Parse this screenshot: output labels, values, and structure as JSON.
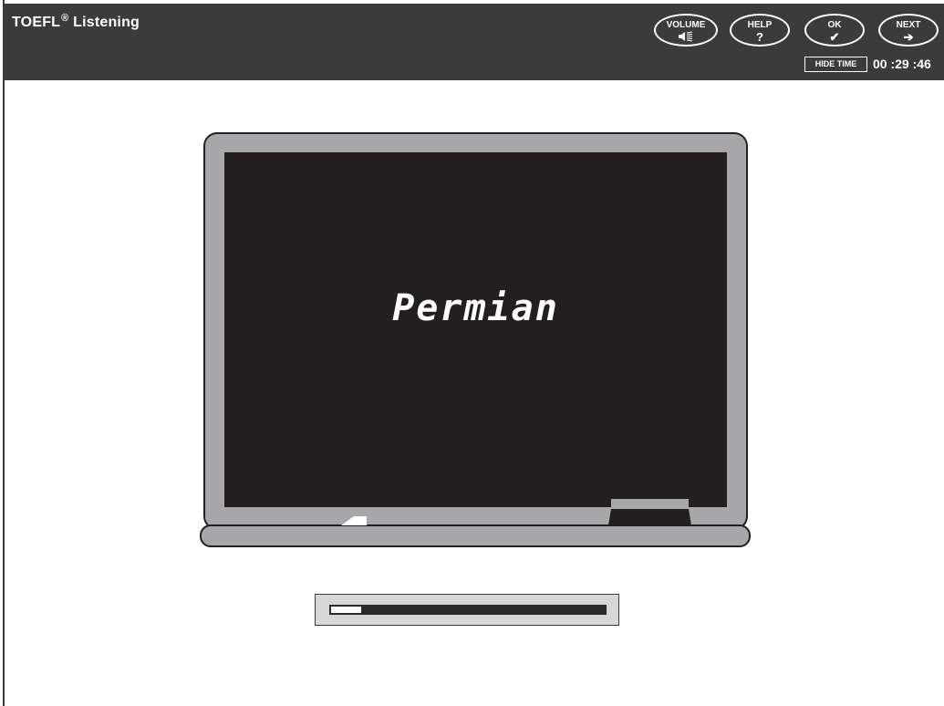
{
  "header": {
    "title": "TOEFL",
    "title_mark": "®",
    "title_suffix": " Listening"
  },
  "toolbar": {
    "volume_label": "VOLUME",
    "volume_icon": "speaker-icon",
    "help_label": "HELP",
    "help_glyph": "?",
    "ok_label": "OK",
    "ok_glyph": "✔",
    "next_label": "NEXT",
    "next_glyph": "➔"
  },
  "timer": {
    "hide_label": "HIDE TIME",
    "value": "00 :29 :46"
  },
  "board": {
    "word": "Permian"
  },
  "progress": {
    "fraction": 0.11
  },
  "colors": {
    "header_bg": "#3b3b3b",
    "board_frame": "#a7a7aa",
    "board_surface": "#231f20"
  }
}
